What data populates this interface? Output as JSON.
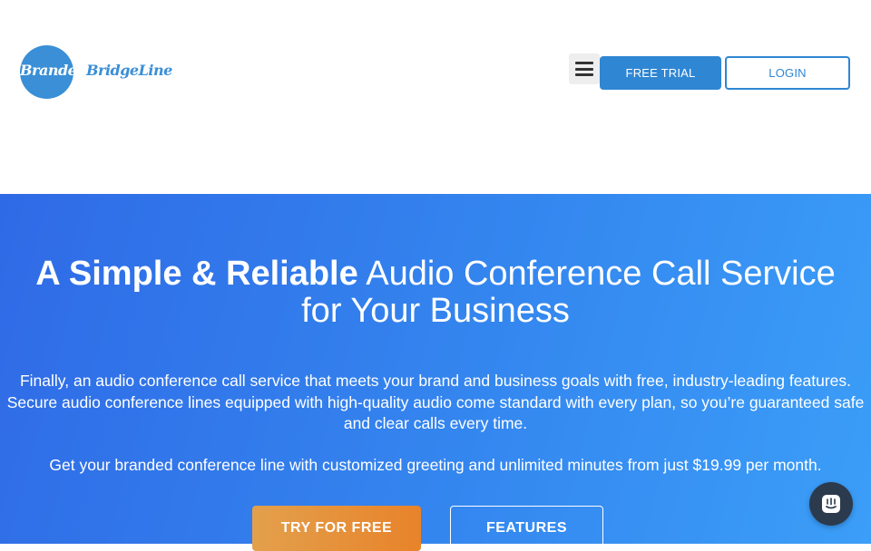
{
  "header": {
    "logo": {
      "part1": "Branded",
      "part2": "Bridge",
      "part3": "Line"
    },
    "menu_icon": "hamburger-menu-icon",
    "free_trial_label": "FREE TRIAL",
    "login_label": "LOGIN"
  },
  "hero": {
    "headline_bold": "A Simple & Reliable",
    "headline_rest": " Audio Conference Call Service for Your Business",
    "paragraph1": "Finally, an audio conference call service that meets your brand and business goals with free, industry-leading features. Secure audio conference lines equipped with high-quality audio come standard with every plan, so you’re guaranteed safe and clear calls every time.",
    "paragraph2": "Get your branded conference line with customized greeting and unlimited minutes from just $19.99 per month.",
    "try_label": "TRY FOR FREE",
    "features_label": "FEATURES"
  },
  "chat": {
    "icon": "chat-icon"
  },
  "colors": {
    "accent": "#2f86d3",
    "hero_start": "#2f6ae6",
    "hero_end": "#3b9ef8",
    "cta_orange": "#e8832a",
    "chat_bg": "#2b3a4c"
  }
}
